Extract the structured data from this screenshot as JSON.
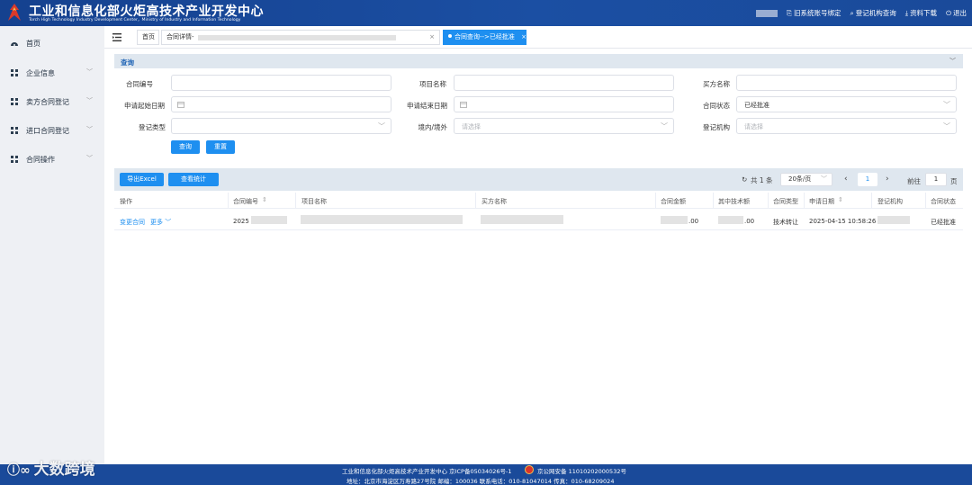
{
  "header": {
    "title_cn": "工业和信息化部火炬高技术产业开发中心",
    "title_en": "Torch High Technology Industry Development Center，Ministry of Industry and Information Technology",
    "links": [
      "旧系统账号绑定",
      "登记机构查询",
      "资料下载",
      "退出"
    ]
  },
  "sidebar": {
    "items": [
      {
        "label": "首页",
        "icon": "dashboard-icon"
      },
      {
        "label": "企业信息",
        "icon": "grid-icon"
      },
      {
        "label": "卖方合同登记",
        "icon": "grid-icon"
      },
      {
        "label": "进口合同登记",
        "icon": "grid-icon"
      },
      {
        "label": "合同操作",
        "icon": "grid-icon"
      }
    ]
  },
  "tabs": {
    "home": "首页",
    "detail": "合同详情-",
    "active": "合同查询-->已经批准"
  },
  "query": {
    "title": "查询",
    "fields": {
      "contract_no": {
        "label": "合同编号",
        "value": ""
      },
      "project_name": {
        "label": "项目名称",
        "value": ""
      },
      "buyer_name": {
        "label": "买方名称",
        "value": ""
      },
      "apply_start": {
        "label": "申请起始日期",
        "value": ""
      },
      "apply_end": {
        "label": "申请结束日期",
        "value": ""
      },
      "status": {
        "label": "合同状态",
        "value": "已经批准"
      },
      "reg_type": {
        "label": "登记类型",
        "value": ""
      },
      "domestic": {
        "label": "境内/境外",
        "placeholder": "请选择"
      },
      "reg_org": {
        "label": "登记机构",
        "placeholder": "请选择"
      }
    },
    "search_btn": "查询",
    "reset_btn": "重置"
  },
  "results": {
    "export_btn": "导出Excel",
    "stats_btn": "查看统计",
    "total": "共 1 条",
    "page_size": "20条/页",
    "current_page": "1",
    "goto_label": "前往",
    "goto_value": "1",
    "page_suffix": "页",
    "columns": [
      "操作",
      "合同编号",
      "项目名称",
      "买方名称",
      "合同金额",
      "其中技术额",
      "合同类型",
      "申请日期",
      "登记机构",
      "合同状态"
    ],
    "rows": [
      {
        "action_change": "变更合同",
        "action_more": "更多",
        "contract_no": "2025",
        "amount": ".00",
        "tech_amount": ".00",
        "type": "技术转让",
        "date": "2025-04-15 10:58:26",
        "status": "已经批准"
      }
    ]
  },
  "footer": {
    "line1": "工业和信息化部火炬高技术产业开发中心  京ICP备05034026号-1",
    "police": "京公网安备 11010202000532号",
    "line2": "地址：北京市海淀区万寿路27号院 邮编：100036 联系电话：010-81047014       传真：010-68209024"
  },
  "watermark": "大数跨境"
}
